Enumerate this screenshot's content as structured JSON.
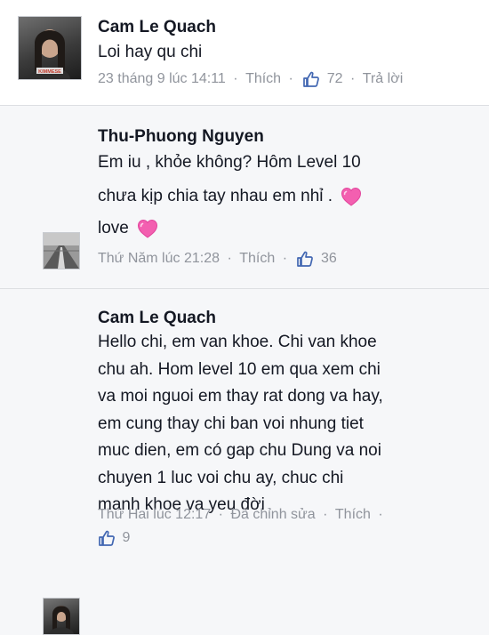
{
  "comments": [
    {
      "author": "Cam Le Quach",
      "text_lines": [
        "Loi hay qu chi"
      ],
      "avatar_caption": "KIMMESE",
      "meta": {
        "time": "23 tháng 9 lúc 14:11",
        "like_label": "Thích",
        "likes": "72",
        "reply_label": "Trả lời"
      }
    },
    {
      "author": "Thu-Phuong Nguyen",
      "text_lines": [
        "Em iu , khỏe không? Hôm Level 10",
        "chưa kịp chia tay nhau em nhỉ .",
        "love"
      ],
      "meta": {
        "time": "Thứ Năm lúc 21:28",
        "like_label": "Thích",
        "likes": "36"
      }
    },
    {
      "author": "Cam Le Quach",
      "text_lines": [
        "Hello chi, em van khoe. Chi van khoe",
        "chu ah. Hom level 10 em qua xem chi",
        "va moi nguoi em thay rat dong va hay,",
        "em cung thay chi ban voi nhung tiet",
        "muc dien, em có gap chu Dung va noi",
        "chuyen 1 luc voi chu ay, chuc chi",
        "manh khoe va yeu đời"
      ],
      "meta": {
        "time": "Thứ Hai lúc 12:17",
        "edited_label": "Đã chỉnh sửa",
        "like_label": "Thích",
        "likes": "9"
      }
    }
  ],
  "separator": "·",
  "colors": {
    "text": "#141823",
    "meta": "#90949c",
    "like_blue": "#4267b2",
    "heart": "#f35fb0"
  },
  "icons": [
    "thumbs-up-icon",
    "heart-icon"
  ]
}
